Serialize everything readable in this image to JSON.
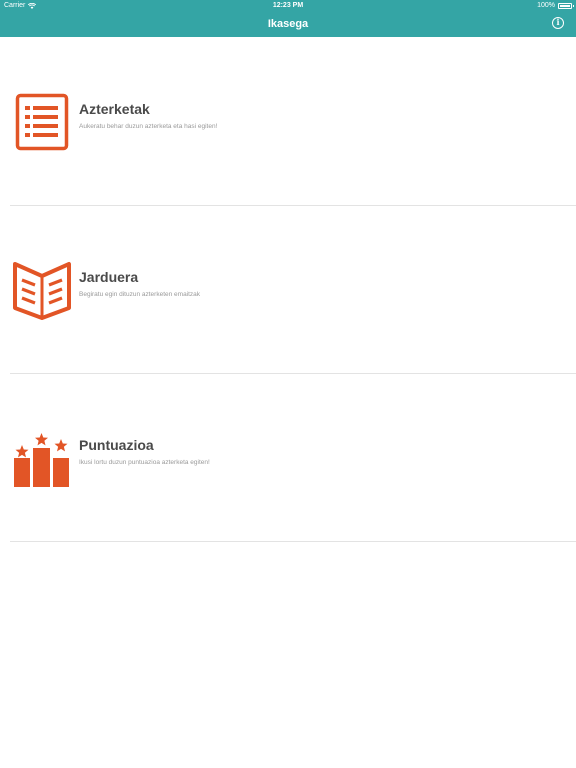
{
  "status_bar": {
    "carrier": "Carrier",
    "time": "12:23 PM",
    "battery": "100%"
  },
  "nav": {
    "title": "Ikasega"
  },
  "colors": {
    "bar": "#34a5a5",
    "accent": "#e25526"
  },
  "menu": [
    {
      "title": "Azterketak",
      "subtitle": "Aukeratu behar duzun azterketa eta hasi egiten!",
      "icon": "list-icon"
    },
    {
      "title": "Jarduera",
      "subtitle": "Begiratu egin dituzun azterketen emaitzak",
      "icon": "open-book-icon"
    },
    {
      "title": "Puntuazioa",
      "subtitle": "Ikusi lortu duzun puntuazioa azterketa egiten!",
      "icon": "podium-stars-icon"
    }
  ]
}
